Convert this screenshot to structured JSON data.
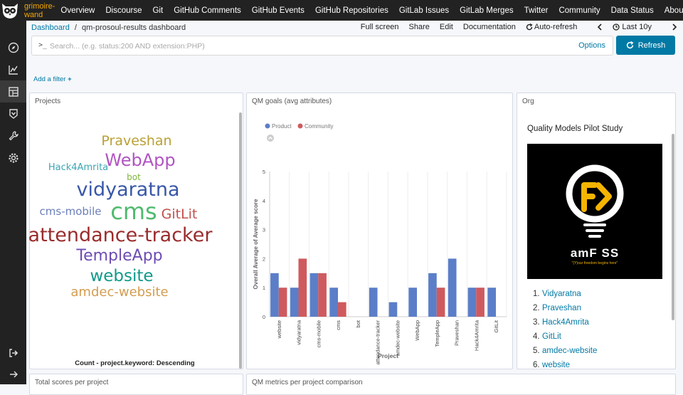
{
  "app": {
    "brand": "grimoire-wand"
  },
  "topnav": [
    "Overview",
    "Discourse",
    "Git",
    "GitHub Comments",
    "GitHub Events",
    "GitHub Repositories",
    "GitLab Issues",
    "GitLab Merges",
    "Twitter",
    "Community",
    "Data Status",
    "About"
  ],
  "breadcrumb": {
    "root": "Dashboard",
    "sep": "/",
    "current": "qm-prosoul-results dashboard"
  },
  "actions": {
    "fullscreen": "Full screen",
    "share": "Share",
    "edit": "Edit",
    "documentation": "Documentation",
    "autorefresh": "Auto-refresh",
    "timerange": "Last 10y"
  },
  "search": {
    "prompt": ">_",
    "placeholder": "Search... (e.g. status:200 AND extension:PHP)",
    "options": "Options",
    "refresh": "Refresh"
  },
  "filter": {
    "add": "Add a filter"
  },
  "panels": {
    "projects": {
      "title": "Projects",
      "footer": "Count - project.keyword: Descending"
    },
    "goals": {
      "title": "QM goals (avg attributes)"
    },
    "org": {
      "title": "Org",
      "heading": "Quality Models Pilot Study",
      "logo_text": "amF SS",
      "logo_tagline": "\"(Y)our freedom begins here\""
    },
    "total": {
      "title": "Total scores per project"
    },
    "metrics": {
      "title": "QM metrics per project comparison"
    }
  },
  "wordcloud": [
    {
      "text": "Praveshan",
      "color": "#b9a035",
      "size": 19
    },
    {
      "text": "WebApp",
      "color": "#b254c3",
      "size": 24
    },
    {
      "text": "Hack4Amrita",
      "color": "#3aa6b4",
      "size": 13
    },
    {
      "text": "bot",
      "color": "#7fb63a",
      "size": 12
    },
    {
      "text": "vidyaratna",
      "color": "#3857a8",
      "size": 27
    },
    {
      "text": "cms-mobile",
      "color": "#6b7fb8",
      "size": 15
    },
    {
      "text": "cms",
      "color": "#4fba6e",
      "size": 32
    },
    {
      "text": "GitLit",
      "color": "#c0504d",
      "size": 19
    },
    {
      "text": "attendance-tracker",
      "color": "#9a2c2c",
      "size": 27
    },
    {
      "text": "TempleApp",
      "color": "#6d4cb3",
      "size": 22
    },
    {
      "text": "website",
      "color": "#0f9a8a",
      "size": 23
    },
    {
      "text": "amdec-website",
      "color": "#d39d50",
      "size": 18
    }
  ],
  "org_list": [
    {
      "num": "1.",
      "label": "Vidyaratna"
    },
    {
      "num": "2.",
      "label": "Praveshan"
    },
    {
      "num": "3.",
      "label": "Hack4Amrita"
    },
    {
      "num": "4.",
      "label": "GitLit"
    },
    {
      "num": "5.",
      "label": "amdec-website"
    },
    {
      "num": "6.",
      "label": "website"
    }
  ],
  "chart_data": {
    "type": "bar",
    "ylabel": "Overall Average of Average score",
    "xlabel": "Project",
    "ylim": [
      0,
      5
    ],
    "yticks": [
      0,
      1,
      2,
      3,
      4,
      5
    ],
    "categories": [
      "website",
      "vidyaratna",
      "cms-mobile",
      "cms",
      "bot",
      "attendance-tracker",
      "amdec-website",
      "WebApp",
      "TempleApp",
      "Praveshan",
      "Hack4Amrita",
      "GitLit"
    ],
    "series": [
      {
        "name": "Product",
        "color": "#5b7ec8",
        "values": [
          1.5,
          1,
          1.5,
          1,
          0,
          1,
          0.5,
          1,
          1.5,
          2,
          1,
          1
        ]
      },
      {
        "name": "Community",
        "color": "#cf5a5e",
        "values": [
          1,
          2,
          1.5,
          0.5,
          0,
          0,
          0,
          0,
          1,
          0,
          1,
          0
        ]
      }
    ],
    "grid": "vertical",
    "legend": "top-left"
  }
}
